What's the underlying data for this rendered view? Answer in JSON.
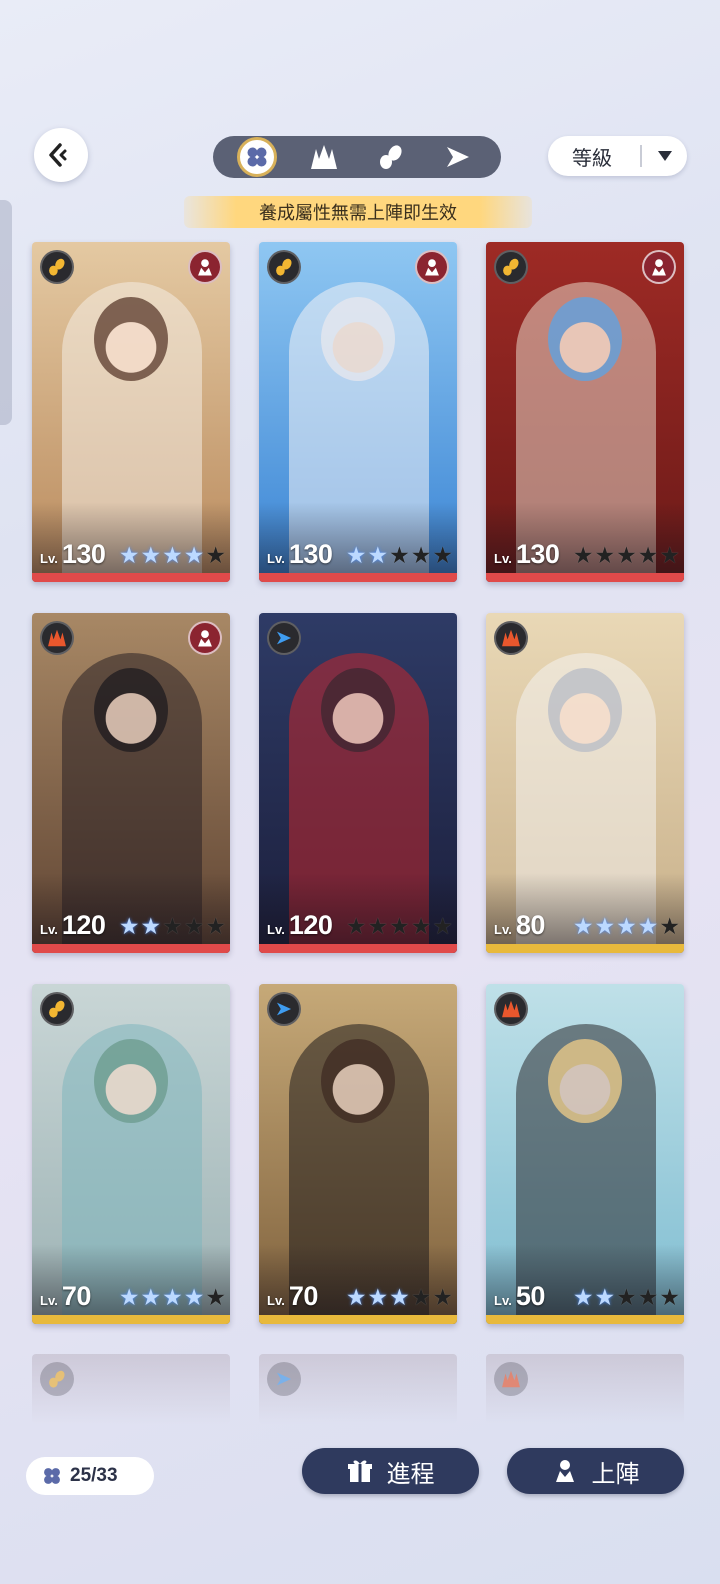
{
  "header": {
    "sort_label": "等級",
    "banner_text": "養成屬性無需上陣即生效",
    "filters": [
      {
        "icon": "clover-all-icon",
        "active": true
      },
      {
        "icon": "fire-element-icon",
        "active": false
      },
      {
        "icon": "lightning-element-icon",
        "active": false
      },
      {
        "icon": "wind-element-icon",
        "active": false
      }
    ]
  },
  "cards": [
    {
      "level": "130",
      "stars": 4,
      "element": "lightning",
      "bar": "#e04a4a",
      "bg": [
        "#e4c9a2",
        "#b98a5d"
      ],
      "figure": "#f4ece4",
      "hair": "#5a3a2c",
      "role": true
    },
    {
      "level": "130",
      "stars": 2,
      "element": "lightning",
      "bar": "#e04a4a",
      "bg": [
        "#8fc7f2",
        "#3a84d4"
      ],
      "figure": "#f2f2f6",
      "hair": "#e8e8ee",
      "role": true
    },
    {
      "level": "130",
      "stars": 0,
      "element": "lightning",
      "bar": "#e04a4a",
      "bg": [
        "#9e2a25",
        "#6b1a18"
      ],
      "figure": "#e7d6c6",
      "hair": "#5aa4e6",
      "role": true
    },
    {
      "level": "120",
      "stars": 2,
      "element": "fire",
      "bar": "#e04a4a",
      "bg": [
        "#a88865",
        "#5f4433"
      ],
      "figure": "#2a2024",
      "hair": "#1d1a1e",
      "role": true
    },
    {
      "level": "120",
      "stars": 0,
      "element": "wind",
      "bar": "#e04a4a",
      "bg": [
        "#2e3b66",
        "#1c1f3c"
      ],
      "figure": "#c2262c",
      "hair": "#3b2630",
      "role": false
    },
    {
      "level": "80",
      "stars": 4,
      "element": "fire",
      "bar": "#e8b93c",
      "bg": [
        "#e9d8b6",
        "#c8b08a"
      ],
      "figure": "#f4f2f0",
      "hair": "#b8bcc6",
      "role": false
    },
    {
      "level": "70",
      "stars": 4,
      "element": "lightning",
      "bar": "#e8b93c",
      "bg": [
        "#c9d6d6",
        "#9cb2b4"
      ],
      "figure": "#7fb7bd",
      "hair": "#6a9a8c",
      "role": false
    },
    {
      "level": "70",
      "stars": 3,
      "element": "wind",
      "bar": "#e8b93c",
      "bg": [
        "#c6a978",
        "#7e603c"
      ],
      "figure": "#1f1c1c",
      "hair": "#3e2a22",
      "role": false
    },
    {
      "level": "50",
      "stars": 2,
      "element": "fire",
      "bar": "#e8b93c",
      "bg": [
        "#bfe0e8",
        "#7fbdd1"
      ],
      "figure": "#2a2a2e",
      "hair": "#f0cd88",
      "role": false
    }
  ],
  "card_common": {
    "lv_prefix": "Lv.",
    "total_stars": 5
  },
  "faded_row": [
    {
      "element": "lightning"
    },
    {
      "element": "wind"
    },
    {
      "element": "fire"
    }
  ],
  "footer": {
    "count": "25/33",
    "progress_label": "進程",
    "deploy_label": "上陣"
  },
  "colors": {
    "lightning": "#f2b632",
    "fire": "#e9572d",
    "wind": "#3f9cf0",
    "accent_gold": "#d8b15a",
    "button_navy": "#2f3a5e"
  }
}
